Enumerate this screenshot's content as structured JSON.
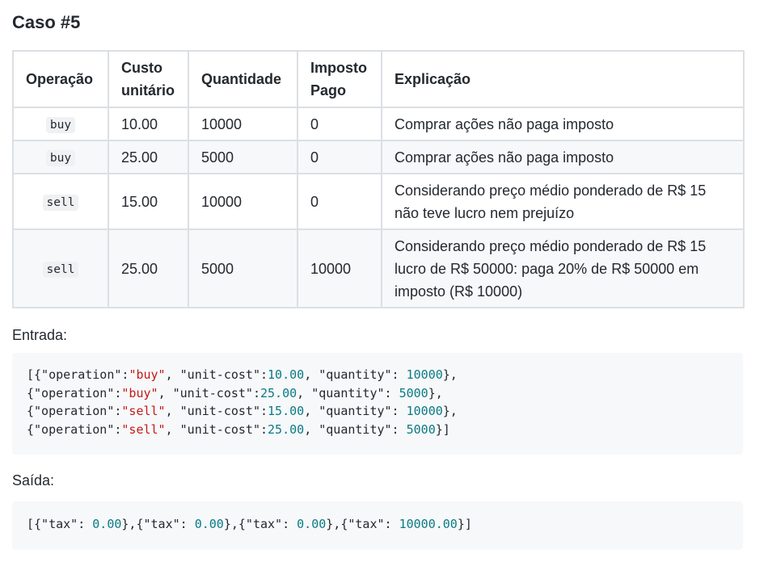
{
  "title": "Caso #5",
  "table": {
    "headers": [
      "Operação",
      "Custo unitário",
      "Quantidade",
      "Imposto Pago",
      "Explicação"
    ],
    "header_lines": [
      [
        "Operação"
      ],
      [
        "Custo",
        "unitário"
      ],
      [
        "Quantidade"
      ],
      [
        "Imposto",
        "Pago"
      ],
      [
        "Explicação"
      ]
    ],
    "rows": [
      {
        "operation": "buy",
        "unit_cost": "10.00",
        "quantity": "10000",
        "tax": "0",
        "explanation": [
          "Comprar ações não paga imposto"
        ]
      },
      {
        "operation": "buy",
        "unit_cost": "25.00",
        "quantity": "5000",
        "tax": "0",
        "explanation": [
          "Comprar ações não paga imposto"
        ]
      },
      {
        "operation": "sell",
        "unit_cost": "15.00",
        "quantity": "10000",
        "tax": "0",
        "explanation": [
          "Considerando preço médio ponderado de R$ 15",
          "não teve lucro nem prejuízo"
        ]
      },
      {
        "operation": "sell",
        "unit_cost": "25.00",
        "quantity": "5000",
        "tax": "10000",
        "explanation": [
          "Considerando preço médio ponderado de R$ 15",
          "lucro de R$ 50000: paga 20% de R$ 50000 em",
          "imposto (R$ 10000)"
        ]
      }
    ]
  },
  "input_label": "Entrada:",
  "input_lines": [
    [
      {
        "t": "[{\"operation\":"
      },
      {
        "t": "\"buy\"",
        "k": "str"
      },
      {
        "t": ", \"unit-cost\":"
      },
      {
        "t": "10.00",
        "k": "num"
      },
      {
        "t": ", \"quantity\": "
      },
      {
        "t": "10000",
        "k": "num"
      },
      {
        "t": "},"
      }
    ],
    [
      {
        "t": "{\"operation\":"
      },
      {
        "t": "\"buy\"",
        "k": "str"
      },
      {
        "t": ", \"unit-cost\":"
      },
      {
        "t": "25.00",
        "k": "num"
      },
      {
        "t": ", \"quantity\": "
      },
      {
        "t": "5000",
        "k": "num"
      },
      {
        "t": "},"
      }
    ],
    [
      {
        "t": "{\"operation\":"
      },
      {
        "t": "\"sell\"",
        "k": "str"
      },
      {
        "t": ", \"unit-cost\":"
      },
      {
        "t": "15.00",
        "k": "num"
      },
      {
        "t": ", \"quantity\": "
      },
      {
        "t": "10000",
        "k": "num"
      },
      {
        "t": "},"
      }
    ],
    [
      {
        "t": "{\"operation\":"
      },
      {
        "t": "\"sell\"",
        "k": "str"
      },
      {
        "t": ", \"unit-cost\":"
      },
      {
        "t": "25.00",
        "k": "num"
      },
      {
        "t": ", \"quantity\": "
      },
      {
        "t": "5000",
        "k": "num"
      },
      {
        "t": "}]"
      }
    ]
  ],
  "output_label": "Saída:",
  "output_lines": [
    [
      {
        "t": "[{\"tax\": "
      },
      {
        "t": "0.00",
        "k": "num"
      },
      {
        "t": "},{\"tax\": "
      },
      {
        "t": "0.00",
        "k": "num"
      },
      {
        "t": "},{\"tax\": "
      },
      {
        "t": "0.00",
        "k": "num"
      },
      {
        "t": "},{\"tax\": "
      },
      {
        "t": "10000.00",
        "k": "num"
      },
      {
        "t": "}]"
      }
    ]
  ],
  "colors": {
    "string_token": "#c41a16",
    "number_token": "#0a7b83",
    "stripe_row": "#f6f8fa",
    "border": "#dcdfe3"
  }
}
